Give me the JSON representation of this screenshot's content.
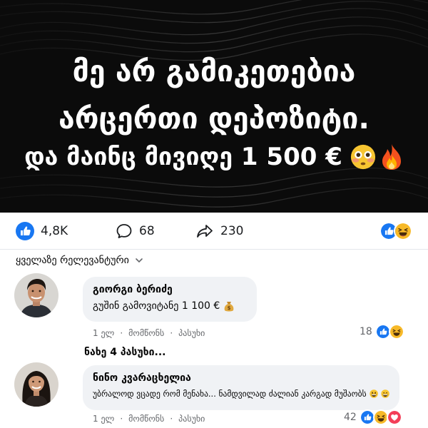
{
  "hero": {
    "line1": "მე არ გამიკეთებია",
    "line2": "არცერთი დეპოზიტი.",
    "line3": "და მაინც მივიღე 1 500 €",
    "emoji1": "flushed-face",
    "emoji2": "fire"
  },
  "stats": {
    "likes": "4,8K",
    "comments": "68",
    "shares": "230",
    "reactions": [
      "like",
      "haha"
    ]
  },
  "sort": {
    "label": "ყველაზე რელევანტური"
  },
  "comments": [
    {
      "name": "გიორგი ბერიძე",
      "text": "გუშინ გამოვიტანე 1 100 €",
      "emoji": "money-bag",
      "time": "1 ელ",
      "like_label": "მომწონს",
      "reply_label": "პასუხი",
      "reaction_count": "18",
      "reactions": [
        "like",
        "haha"
      ]
    },
    {
      "name": "ნინო კვარაცხელია",
      "text": "უბრალოდ ვცადე რომ მენახა... ნამდვილად ძალიან კარგად მუშაობს",
      "emoji": "grinning-face",
      "time": "1 ელ",
      "like_label": "მომწონს",
      "reply_label": "პასუხი",
      "reaction_count": "42",
      "reactions": [
        "like",
        "haha",
        "love"
      ]
    }
  ],
  "view_replies": "ნახე 4 პასუხი...",
  "colors": {
    "like_blue": "#1877f2",
    "haha_yellow": "#f7b928",
    "love_red": "#f33e58",
    "bubble_bg": "#f0f2f5",
    "meta_gray": "#65676b"
  }
}
